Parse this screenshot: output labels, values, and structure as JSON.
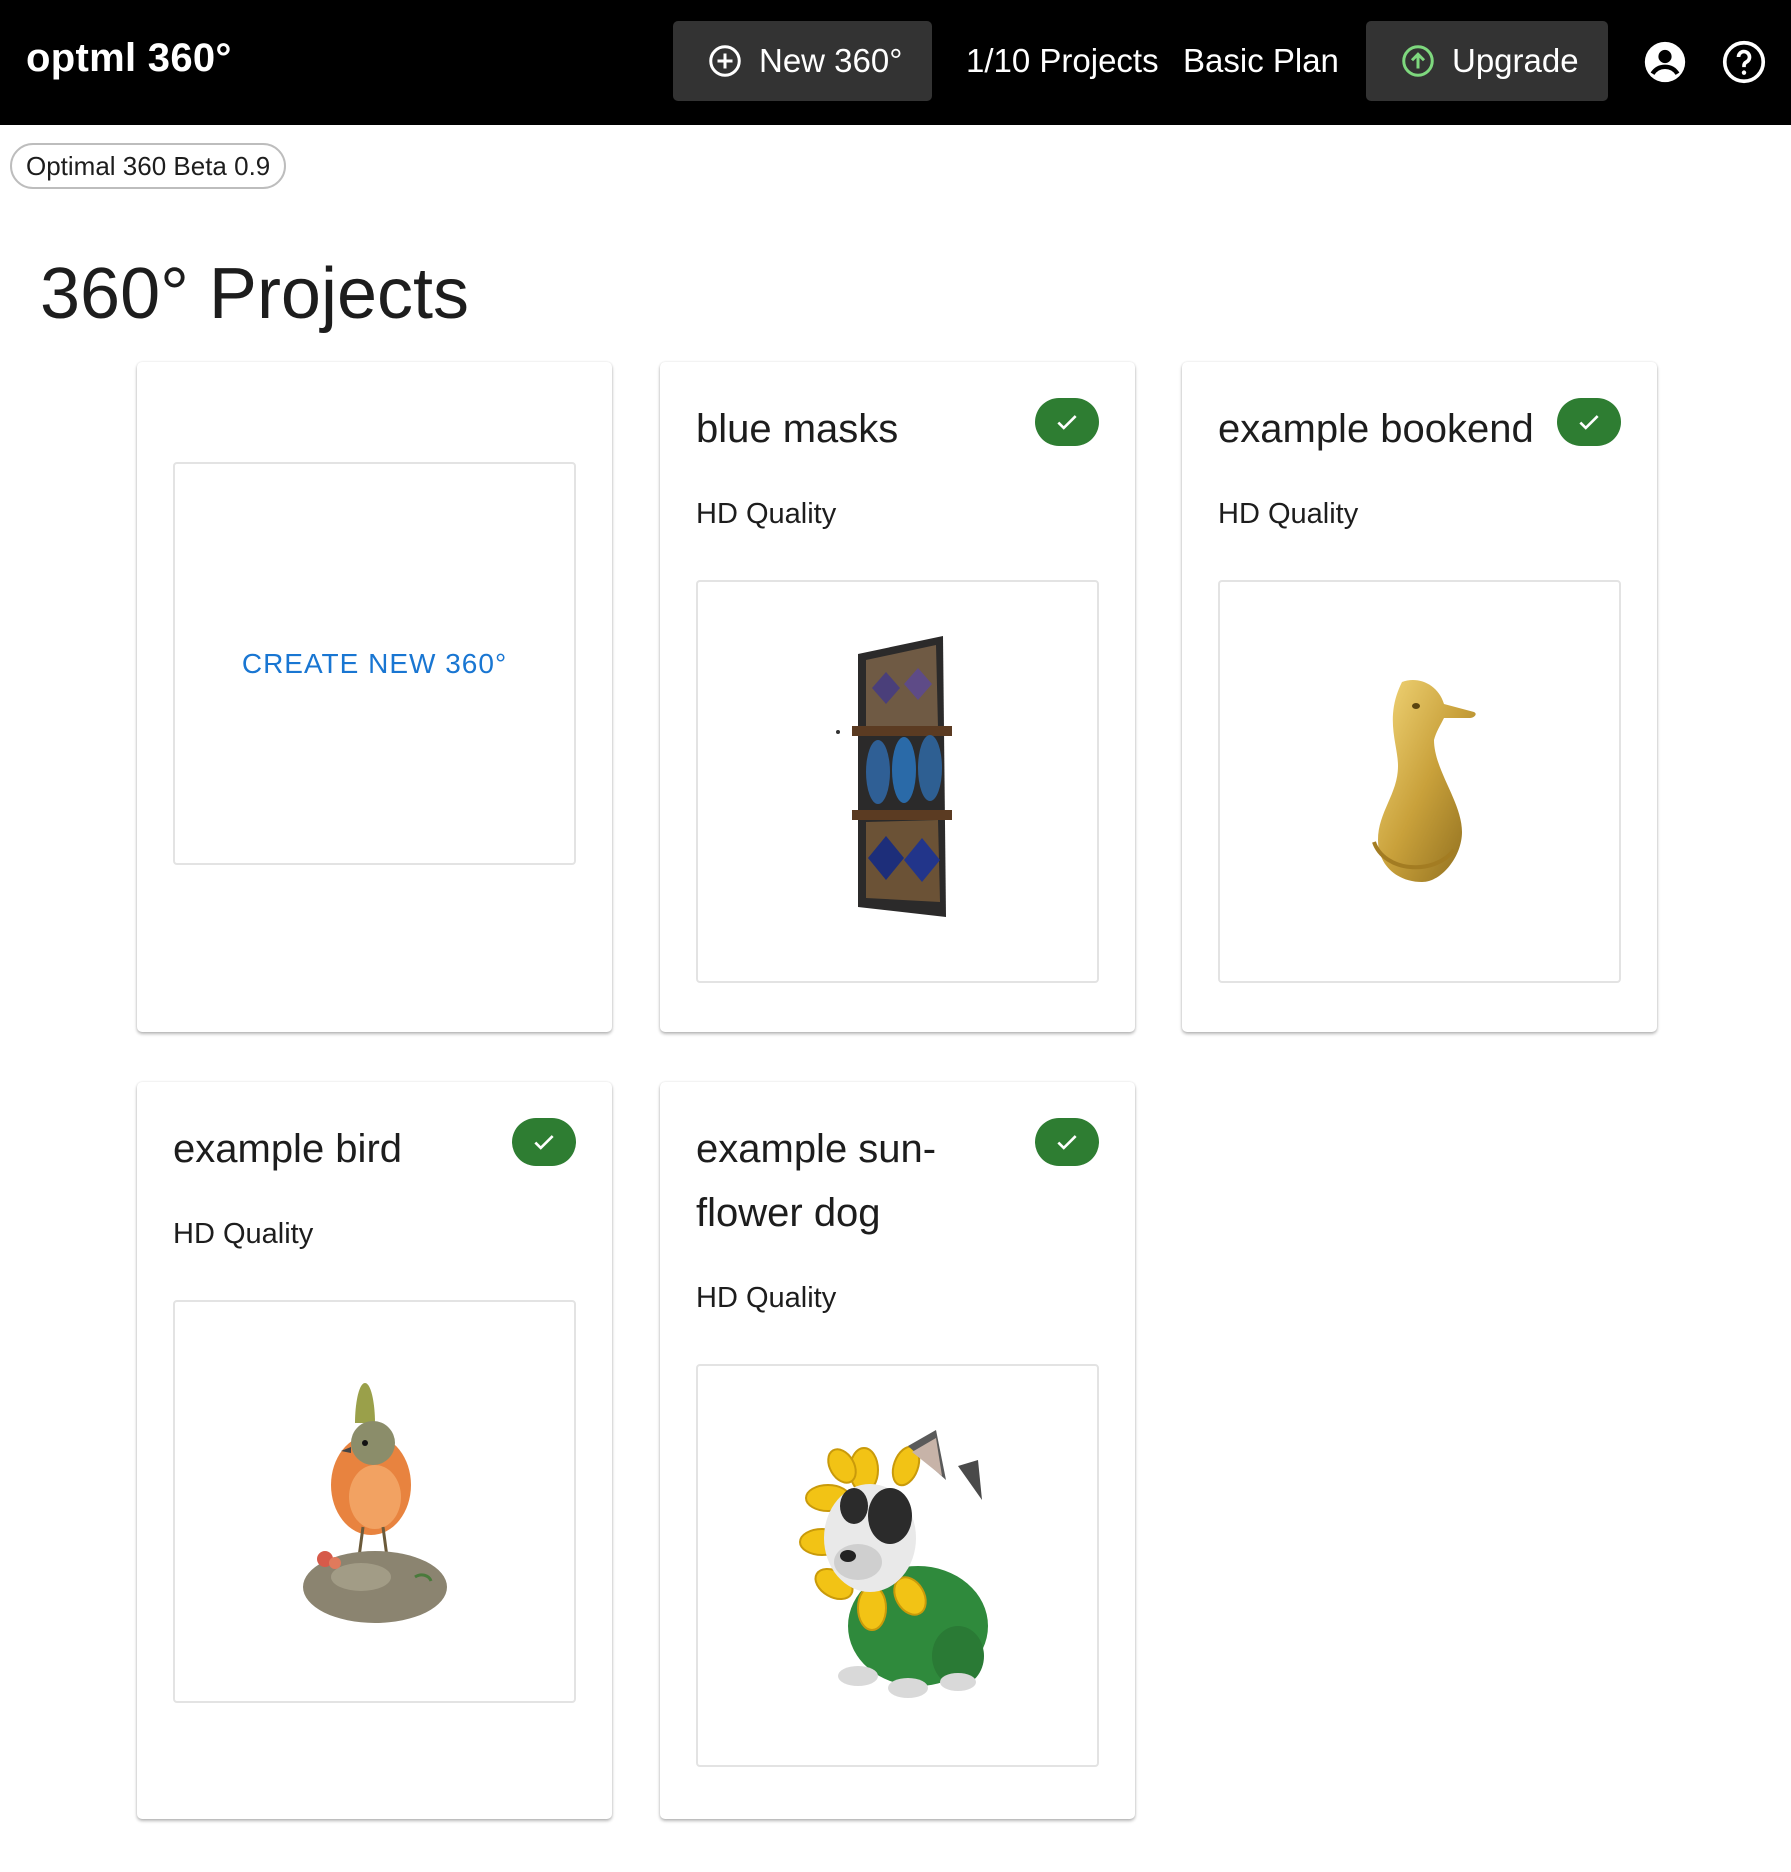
{
  "header": {
    "brand": "optml 360°",
    "new_button_label": "New 360°",
    "projects_count": "1/10 Projects",
    "plan": "Basic Plan",
    "upgrade_label": "Upgrade"
  },
  "version_chip": "Optimal 360 Beta 0.9",
  "page_title": "360° Projects",
  "create_card": {
    "label": "CREATE NEW 360°"
  },
  "projects": [
    {
      "title": "blue masks",
      "quality": "HD Quality",
      "status": "complete",
      "thumbnail": "blue-masks-image"
    },
    {
      "title": "example bookend",
      "quality": "HD Quality",
      "status": "complete",
      "thumbnail": "bookend-image"
    },
    {
      "title": "example bird",
      "quality": "HD Quality",
      "status": "complete",
      "thumbnail": "bird-image"
    },
    {
      "title": "example sun-flower dog",
      "quality": "HD Quality",
      "status": "complete",
      "thumbnail": "sunflower-dog-image"
    }
  ],
  "colors": {
    "header_bg": "#000000",
    "button_bg": "#333333",
    "success": "#2e7d32",
    "link_blue": "#1976d2"
  }
}
